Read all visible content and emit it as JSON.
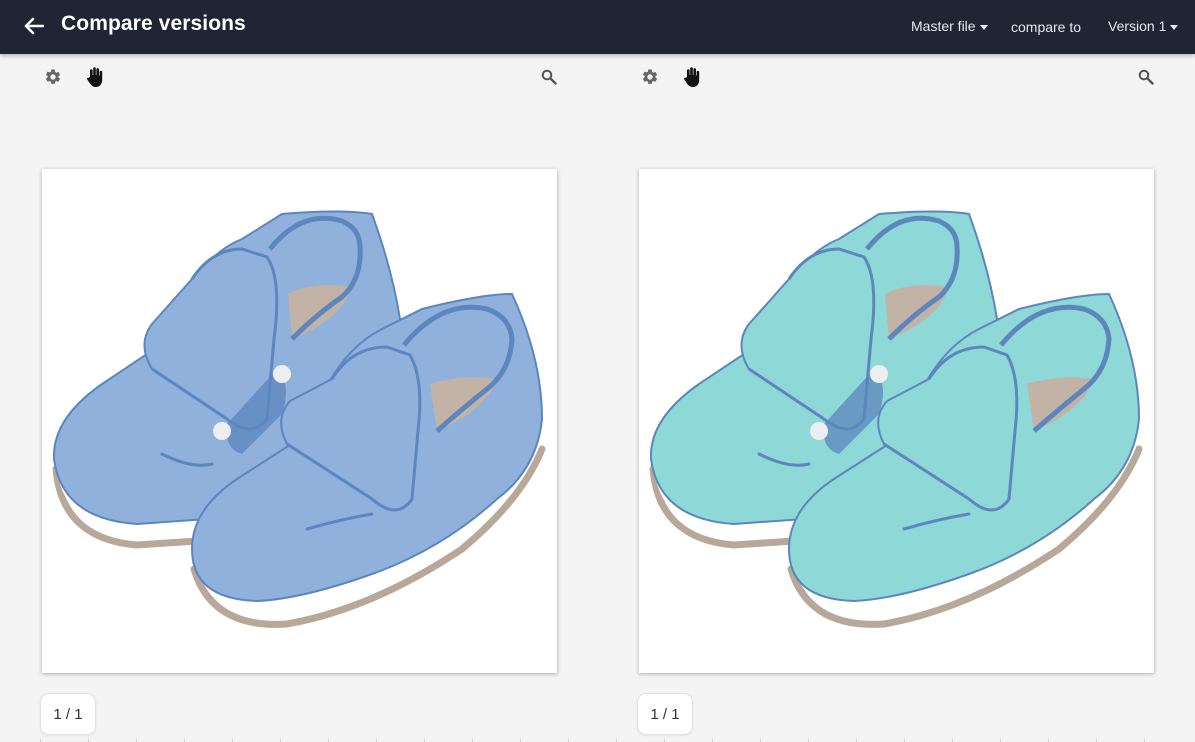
{
  "header": {
    "title": "Compare versions",
    "master_label": "Master file",
    "compare_label": "compare to",
    "version_label": "Version 1",
    "icons": {
      "back": "arrow-left-icon",
      "caret": "caret-down-icon"
    }
  },
  "panes": [
    {
      "tools": {
        "settings": "gear-icon",
        "pan": "hand-icon",
        "zoom": "magnifier-icon"
      },
      "image": {
        "subject": "pair of velcro shoes",
        "color": "#8fb1dc",
        "strap_color": "#5c86bd"
      },
      "pager": "1 / 1"
    },
    {
      "tools": {
        "settings": "gear-icon",
        "pan": "hand-icon",
        "zoom": "magnifier-icon"
      },
      "image": {
        "subject": "pair of velcro shoes",
        "color": "#8ed8d8",
        "strap_color": "#5c86bd"
      },
      "pager": "1 / 1"
    }
  ],
  "colors": {
    "header_bg": "#1f2533",
    "page_bg": "#f4f4f4",
    "sole": "#b8a89a",
    "insole": "#c2b3a6"
  }
}
